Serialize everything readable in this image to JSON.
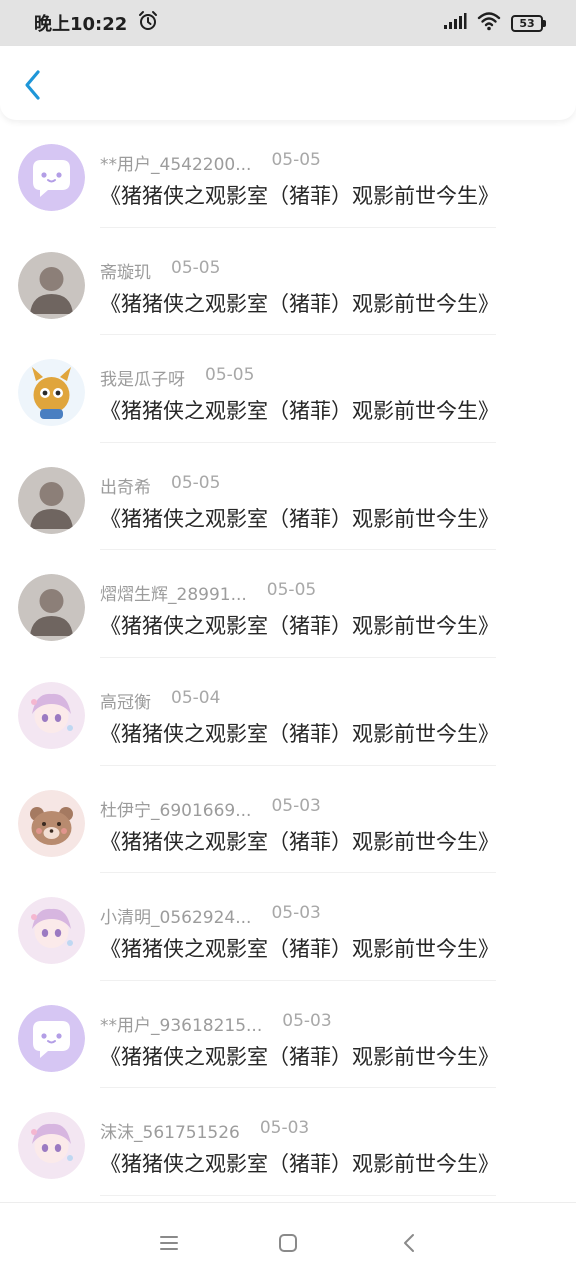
{
  "status_bar": {
    "time": "晚上10:22",
    "battery": "53"
  },
  "colors": {
    "accent": "#1e96d8",
    "status_bar_bg": "#e3e3e3"
  },
  "items": [
    {
      "user": "**用户_4542200...",
      "date": "05-05",
      "title": "《猪猪侠之观影室（猪菲）观影前世今生》",
      "avatar": "default-chat-avatar"
    },
    {
      "user": "斋璇玑",
      "date": "05-05",
      "title": "《猪猪侠之观影室（猪菲）观影前世今生》",
      "avatar": "photo-avatar"
    },
    {
      "user": "我是瓜子呀",
      "date": "05-05",
      "title": "《猪猪侠之观影室（猪菲）观影前世今生》",
      "avatar": "cartoon-avatar"
    },
    {
      "user": "出奇希",
      "date": "05-05",
      "title": "《猪猪侠之观影室（猪菲）观影前世今生》",
      "avatar": "photo-avatar"
    },
    {
      "user": "熠熠生辉_28991...",
      "date": "05-05",
      "title": "《猪猪侠之观影室（猪菲）观影前世今生》",
      "avatar": "photo-avatar"
    },
    {
      "user": "高冠衡",
      "date": "05-04",
      "title": "《猪猪侠之观影室（猪菲）观影前世今生》",
      "avatar": "anime-avatar"
    },
    {
      "user": "杜伊宁_6901669...",
      "date": "05-03",
      "title": "《猪猪侠之观影室（猪菲）观影前世今生》",
      "avatar": "bear-avatar"
    },
    {
      "user": "小清明_0562924...",
      "date": "05-03",
      "title": "《猪猪侠之观影室（猪菲）观影前世今生》",
      "avatar": "anime-avatar"
    },
    {
      "user": "**用户_93618215...",
      "date": "05-03",
      "title": "《猪猪侠之观影室（猪菲）观影前世今生》",
      "avatar": "default-chat-avatar"
    },
    {
      "user": "沫沫_561751526",
      "date": "05-03",
      "title": "《猪猪侠之观影室（猪菲）观影前世今生》",
      "avatar": "anime-avatar"
    }
  ]
}
